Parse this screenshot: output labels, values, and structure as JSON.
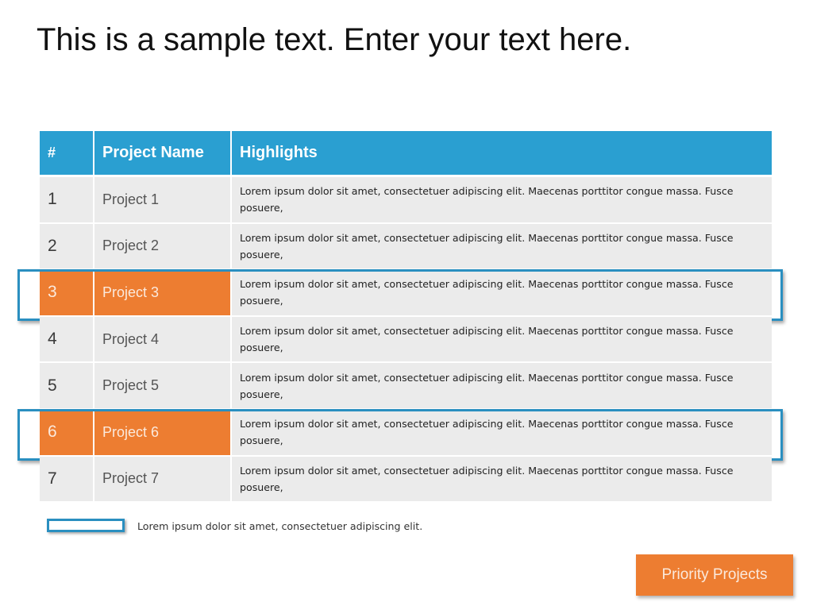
{
  "title": "This is a sample text. Enter your text here.",
  "table": {
    "headers": [
      "#",
      "Project Name",
      "Highlights"
    ],
    "rows": [
      {
        "num": "1",
        "name": "Project 1",
        "highlight": "Lorem ipsum dolor sit amet, consectetuer adipiscing elit. Maecenas porttitor congue massa. Fusce posuere,",
        "highlighted": false
      },
      {
        "num": "2",
        "name": "Project 2",
        "highlight": "Lorem ipsum dolor sit amet, consectetuer adipiscing elit. Maecenas porttitor congue massa. Fusce posuere,",
        "highlighted": false
      },
      {
        "num": "3",
        "name": "Project 3",
        "highlight": "Lorem ipsum dolor sit amet, consectetuer adipiscing elit. Maecenas porttitor congue massa. Fusce posuere,",
        "highlighted": true
      },
      {
        "num": "4",
        "name": "Project 4",
        "highlight": "Lorem ipsum dolor sit amet, consectetuer adipiscing elit. Maecenas porttitor congue massa. Fusce posuere,",
        "highlighted": false
      },
      {
        "num": "5",
        "name": "Project 5",
        "highlight": "Lorem ipsum dolor sit amet, consectetuer adipiscing elit. Maecenas porttitor congue massa. Fusce posuere,",
        "highlighted": false
      },
      {
        "num": "6",
        "name": "Project 6",
        "highlight": "Lorem ipsum dolor sit amet, consectetuer adipiscing elit. Maecenas porttitor congue massa. Fusce posuere,",
        "highlighted": true
      },
      {
        "num": "7",
        "name": "Project 7",
        "highlight": "Lorem ipsum dolor sit amet, consectetuer adipiscing elit. Maecenas porttitor congue massa. Fusce posuere,",
        "highlighted": false
      }
    ]
  },
  "legend": {
    "text": "Lorem ipsum dolor sit amet, consectetuer adipiscing elit."
  },
  "priority_button": {
    "label": "Priority Projects"
  },
  "colors": {
    "header_blue": "#2a9fd1",
    "highlight_orange": "#ed7d31",
    "outline_blue": "#2a8fc0",
    "row_gray": "#ebebeb"
  }
}
